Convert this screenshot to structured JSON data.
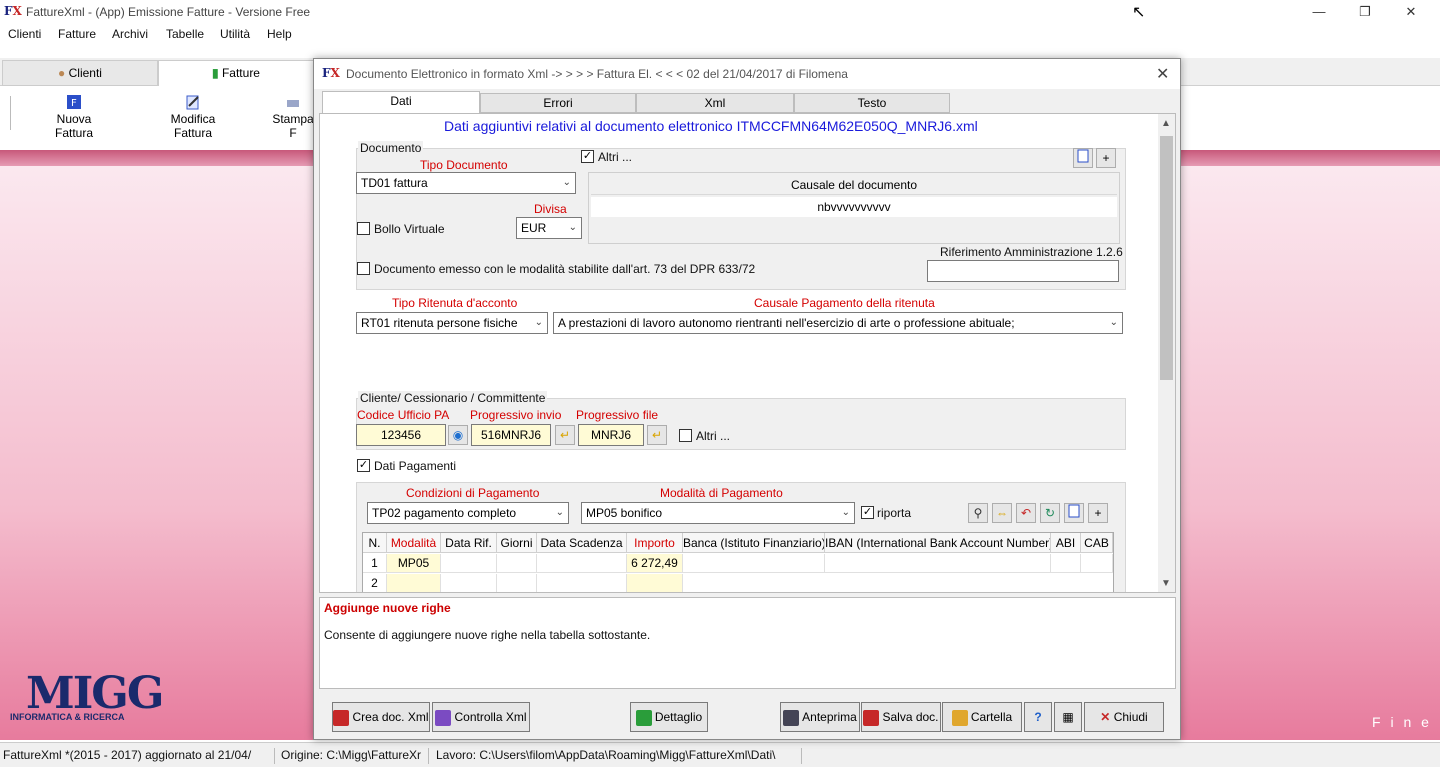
{
  "main": {
    "title": "FattureXml  - (App) Emissione Fatture - Versione Free",
    "menu": [
      "Clienti",
      "Fatture",
      "Archivi",
      "Tabelle",
      "Utilità",
      "Help"
    ],
    "ribbon_tabs": [
      "Clienti",
      "Fatture"
    ],
    "ribbon_buttons": [
      "Nuova Fattura",
      "Modifica Fattura",
      "Stampa F"
    ],
    "fine": "F i n e",
    "logo_word": "MIGG",
    "logo_sub": "INFORMATICA & RICERCA"
  },
  "statusbar": {
    "cell1": "FattureXml *(2015 - 2017)  aggiornato al 21/04/",
    "cell2": "Origine: C:\\Migg\\FattureXr",
    "cell3": "Lavoro: C:\\Users\\filom\\AppData\\Roaming\\Migg\\FattureXml\\Dati\\"
  },
  "dialog": {
    "title": "Documento Elettronico in formato Xml -> > > > Fattura El. < < < 02 del 21/04/2017 di Filomena",
    "tabs": [
      "Dati",
      "Errori",
      "Xml",
      "Testo"
    ],
    "heading": "Dati aggiuntivi relativi al documento elettronico  ITMCCFMN64M62E050Q_MNRJ6.xml",
    "documento": {
      "group_title": "Documento",
      "tipo_label": "Tipo Documento",
      "tipo_value": "TD01    fattura",
      "altri_label": "Altri ...",
      "causale_header": "Causale del documento",
      "causale_value": "nbvvvvvvvvvv",
      "bollo_label": "Bollo Virtuale",
      "divisa_label": "Divisa",
      "divisa_value": "EUR",
      "art73_label": "Documento emesso con le modalità stabilite dall'art. 73 del DPR  633/72",
      "rif_label": "Riferimento Amministrazione 1.2.6",
      "rif_value": ""
    },
    "ritenuta": {
      "tipo_label": "Tipo Ritenuta d'acconto",
      "tipo_value": "RT01  ritenuta persone fisiche",
      "causale_label": "Causale Pagamento della ritenuta",
      "causale_value": "A   prestazioni di lavoro autonomo rientranti nell'esercizio di arte o professione abituale;"
    },
    "cliente": {
      "group_title": "Cliente/ Cessionario / Committente",
      "codice_label": "Codice Ufficio PA",
      "codice_value": "123456",
      "progr_invio_label": "Progressivo invio",
      "progr_invio_value": "516MNRJ6",
      "progr_file_label": "Progressivo file",
      "progr_file_value": "MNRJ6",
      "altri_label": "Altri ..."
    },
    "pagamenti": {
      "check_label": "Dati Pagamenti",
      "condizioni_label": "Condizioni di Pagamento",
      "condizioni_value": "TP02  pagamento completo",
      "modalita_label": "Modalità di Pagamento",
      "modalita_value": "MP05  bonifico",
      "riporta_label": "riporta",
      "columns": [
        "N.",
        "Modalità",
        "Data Rif.",
        "Giorni",
        "Data Scadenza",
        "Importo",
        "Banca (Istituto Finanziario)",
        "IBAN (International Bank Account Number)",
        "ABI",
        "CAB"
      ],
      "rows": [
        {
          "n": "1",
          "modalita": "MP05",
          "importo": "6 272,49"
        },
        {
          "n": "2",
          "modalita": "",
          "importo": ""
        }
      ]
    },
    "help": {
      "title": "Aggiunge nuove righe",
      "text": "Consente di aggiungere nuove righe nella tabella sottostante."
    },
    "buttons": {
      "crea": "Crea doc. Xml",
      "controlla": "Controlla Xml",
      "dettaglio": "Dettaglio",
      "anteprima": "Anteprima",
      "salva": "Salva doc.",
      "cartella": "Cartella",
      "chiudi": "Chiudi"
    }
  }
}
